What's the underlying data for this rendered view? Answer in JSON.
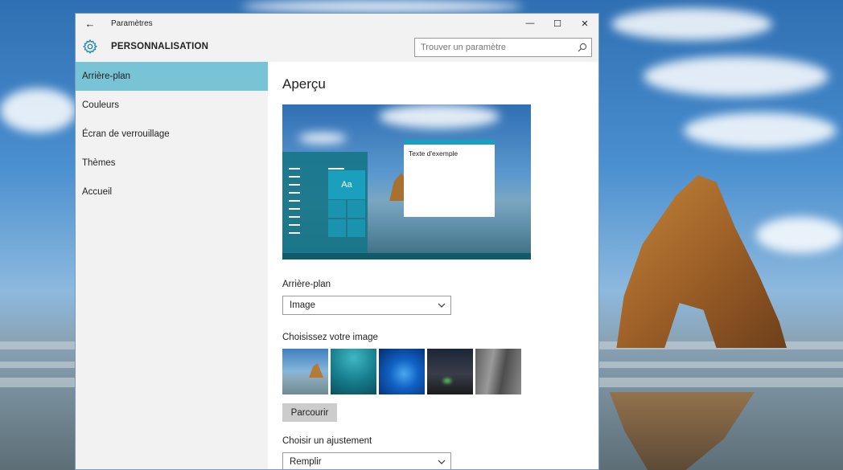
{
  "window": {
    "title": "Paramètres",
    "section_title": "PERSONNALISATION",
    "back_glyph": "←",
    "minimize_glyph": "—",
    "maximize_glyph": "☐",
    "close_glyph": "✕"
  },
  "search": {
    "placeholder": "Trouver un paramètre"
  },
  "sidebar": {
    "items": [
      {
        "label": "Arrière-plan",
        "active": true
      },
      {
        "label": "Couleurs",
        "active": false
      },
      {
        "label": "Écran de verrouillage",
        "active": false
      },
      {
        "label": "Thèmes",
        "active": false
      },
      {
        "label": "Accueil",
        "active": false
      }
    ]
  },
  "content": {
    "preview_title": "Aperçu",
    "preview_sample_text": "Texte d'exemple",
    "preview_tile_text": "Aa",
    "background_label": "Arrière-plan",
    "background_value": "Image",
    "choose_image_label": "Choisissez votre image",
    "browse_label": "Parcourir",
    "fit_label": "Choisir un ajustement",
    "fit_value": "Remplir"
  },
  "icons": {
    "gear": "gear-icon",
    "search": "search-icon",
    "chevron": "chevron-down-icon"
  },
  "colors": {
    "accent": "#78c3d6",
    "tile": "#1aa0bd",
    "sidebar_bg": "#f2f2f2"
  }
}
